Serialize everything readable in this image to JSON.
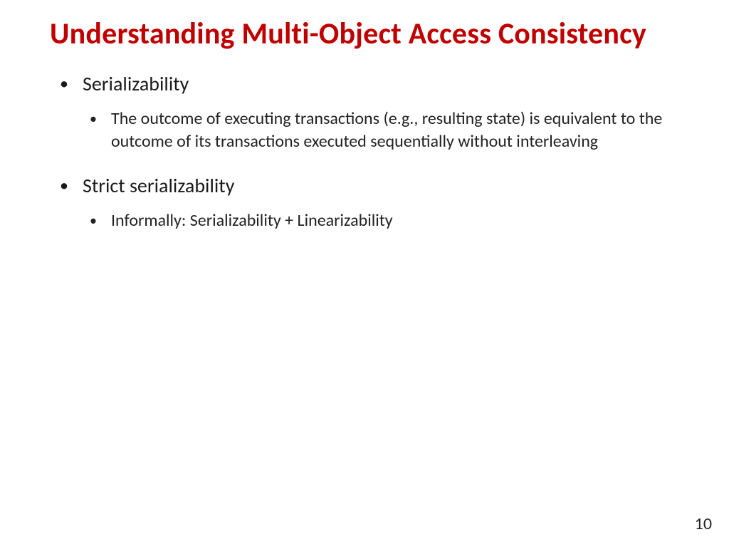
{
  "title": "Understanding Multi-Object Access Consistency",
  "bullets": [
    {
      "label": "Serializability",
      "sub": [
        "The outcome of executing transactions (e.g., resulting state) is equivalent to the outcome of its transactions executed sequentially without interleaving"
      ]
    },
    {
      "label": "Strict serializability",
      "sub": [
        "Informally: Serializability + Linearizability"
      ]
    }
  ],
  "page_number": "10"
}
